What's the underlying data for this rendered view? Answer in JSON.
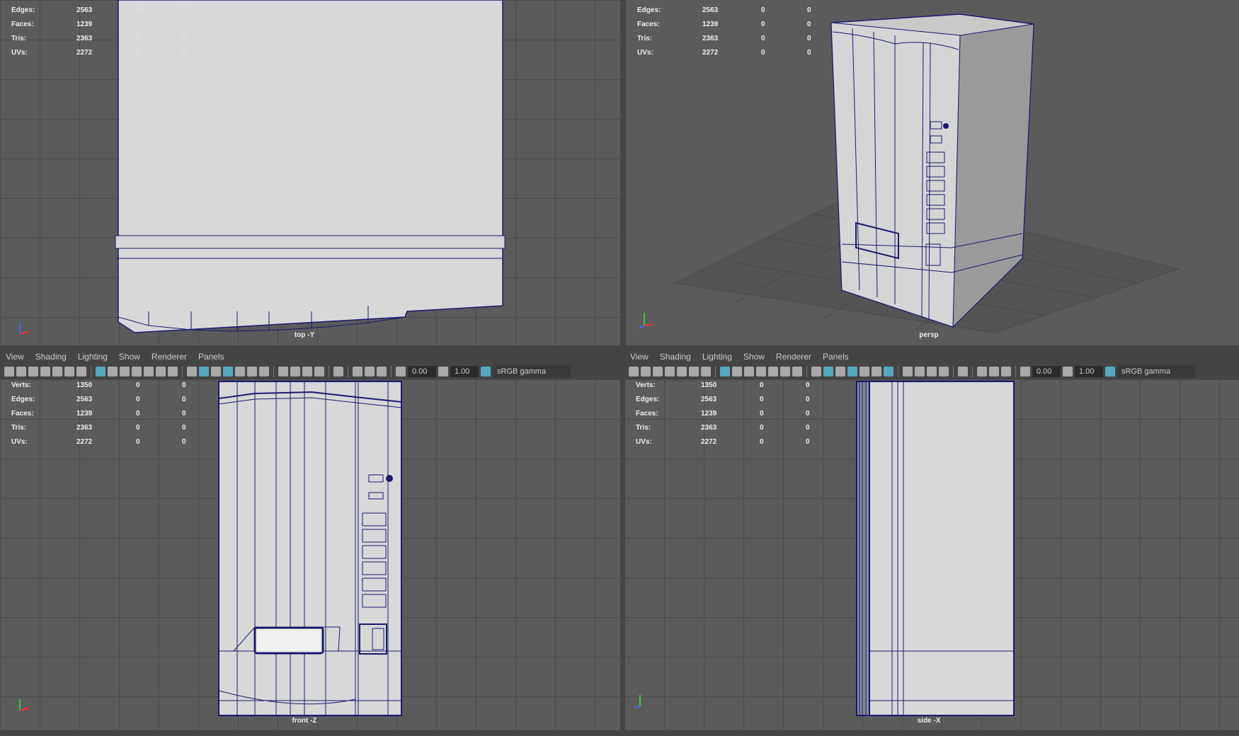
{
  "menus": [
    "View",
    "Shading",
    "Lighting",
    "Show",
    "Renderer",
    "Panels"
  ],
  "toolbar": {
    "exposure": "0.00",
    "gamma": "1.00",
    "color_management": "sRGB gamma"
  },
  "stats_labels": [
    "Verts:",
    "Edges:",
    "Faces:",
    "Tris:",
    "UVs:"
  ],
  "stats": {
    "Verts:": [
      "1350",
      "0",
      "0"
    ],
    "Edges:": [
      "2563",
      "0",
      "0"
    ],
    "Faces:": [
      "1239",
      "0",
      "0"
    ],
    "Tris:": [
      "2363",
      "0",
      "0"
    ],
    "UVs:": [
      "2272",
      "0",
      "0"
    ]
  },
  "views": {
    "top": "top -Y",
    "persp": "persp",
    "front": "front -Z",
    "side": "side -X"
  },
  "colors": {
    "wire": "#1a1a6e",
    "surface": "#d8d8d8",
    "accent": "#5cb8d6"
  }
}
